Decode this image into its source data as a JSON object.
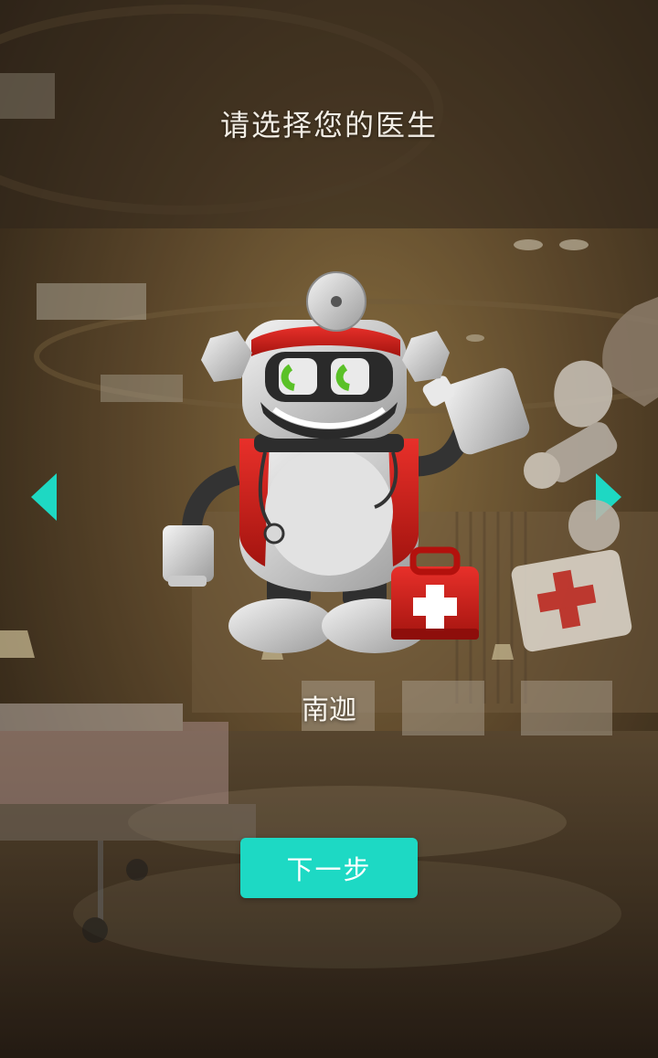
{
  "header": {
    "title": "请选择您的医生"
  },
  "carousel": {
    "prev_icon": "chevron-left-icon",
    "next_icon": "chevron-right-icon",
    "arrow_color": "#1ed8c3",
    "current_doctor": {
      "name": "南迦",
      "avatar": "robot-doctor-avatar"
    },
    "next_doctor": {
      "avatar": "robot-doctor-avatar-partial"
    }
  },
  "actions": {
    "next_label": "下一步",
    "accent": "#1dd9c4"
  }
}
